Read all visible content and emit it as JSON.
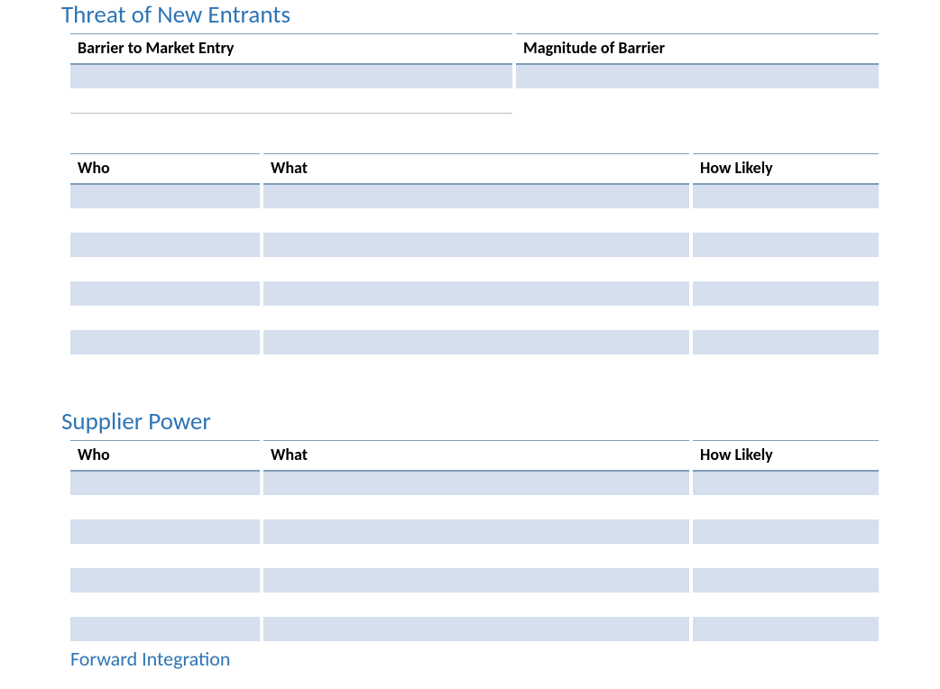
{
  "sections": {
    "threat_of_new_entrants": {
      "heading": "Threat of New Entrants",
      "barrier_table": {
        "headers": {
          "barrier": "Barrier to Market Entry",
          "magnitude": "Magnitude of Barrier"
        },
        "rows": [
          {
            "barrier": "",
            "magnitude": ""
          },
          {
            "barrier": "",
            "magnitude": ""
          }
        ]
      },
      "entrants_table": {
        "headers": {
          "who": "Who",
          "what": "What",
          "how_likely": "How Likely"
        },
        "rows": [
          {
            "who": "",
            "what": "",
            "how_likely": ""
          },
          {
            "who": "",
            "what": "",
            "how_likely": ""
          },
          {
            "who": "",
            "what": "",
            "how_likely": ""
          },
          {
            "who": "",
            "what": "",
            "how_likely": ""
          },
          {
            "who": "",
            "what": "",
            "how_likely": ""
          },
          {
            "who": "",
            "what": "",
            "how_likely": ""
          },
          {
            "who": "",
            "what": "",
            "how_likely": ""
          }
        ]
      }
    },
    "supplier_power": {
      "heading": "Supplier Power",
      "suppliers_table": {
        "headers": {
          "who": "Who",
          "what": "What",
          "how_likely": "How Likely"
        },
        "rows": [
          {
            "who": "",
            "what": "",
            "how_likely": ""
          },
          {
            "who": "",
            "what": "",
            "how_likely": ""
          },
          {
            "who": "",
            "what": "",
            "how_likely": ""
          },
          {
            "who": "",
            "what": "",
            "how_likely": ""
          },
          {
            "who": "",
            "what": "",
            "how_likely": ""
          },
          {
            "who": "",
            "what": "",
            "how_likely": ""
          },
          {
            "who": "",
            "what": "",
            "how_likely": ""
          }
        ]
      },
      "forward_integration_heading": "Forward Integration"
    }
  }
}
